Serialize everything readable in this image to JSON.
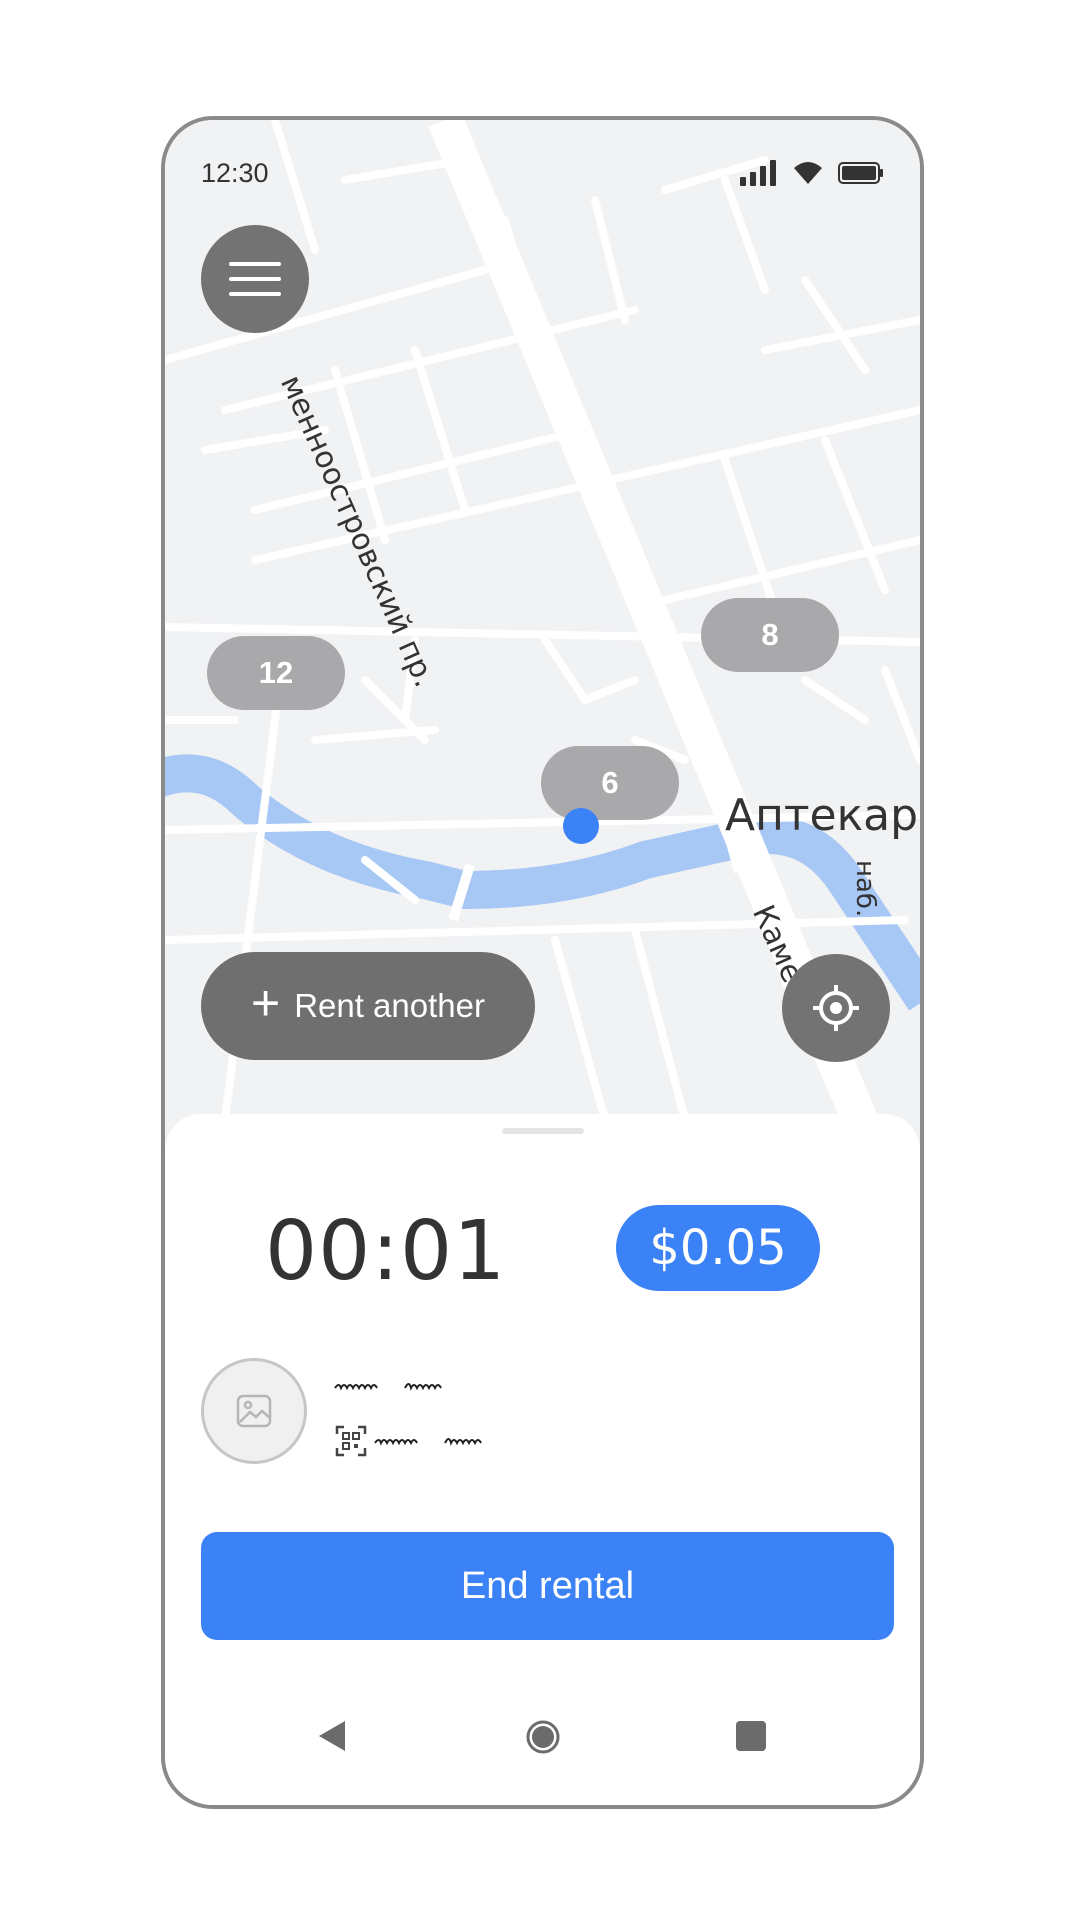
{
  "status_bar": {
    "time": "12:30"
  },
  "map": {
    "clusters": [
      {
        "count": "12"
      },
      {
        "count": "8"
      },
      {
        "count": "6"
      }
    ],
    "labels": {
      "street_main": "Каменноостровский пр.",
      "street_main_visible": "менноостровский пр.",
      "district": "Аптекар",
      "embankment": "наб.",
      "street_lower": "Каменноо"
    }
  },
  "actions": {
    "rent_another_label": "Rent another"
  },
  "rental": {
    "timer": "00:01",
    "price": "$0.05",
    "end_label": "End rental"
  },
  "colors": {
    "accent": "#3b82f6",
    "fab": "#737373",
    "cluster": "#a9a9ab",
    "water": "#a7c7f5",
    "map_bg": "#f1f2f4"
  },
  "icons": {
    "menu": "menu-icon",
    "locate": "crosshair-icon",
    "thumbnail": "image-placeholder-icon",
    "code": "qr-code-icon"
  }
}
